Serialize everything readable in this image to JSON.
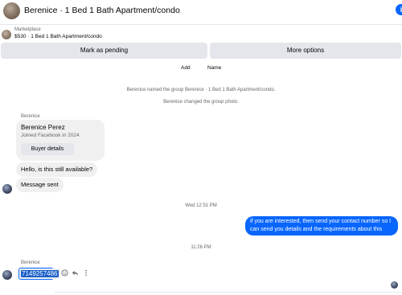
{
  "header": {
    "title": "Berenice · 1 Bed 1 Bath Apartment/condo",
    "info_icon": "info-icon"
  },
  "marketplace": {
    "label": "Marketplace",
    "item": "$530 · 1 Bed 1 Bath Apartment/condo"
  },
  "actions": {
    "pending": "Mark as pending",
    "more": "More options"
  },
  "add_name": {
    "add": "Add",
    "name": "Name"
  },
  "system": {
    "line1": "Berenice named the group Berenice · 1 Bed 1 Bath Apartment/condo.",
    "line2": "Berenice changed the group photo."
  },
  "buyer": {
    "sender": "Berenice",
    "name": "Berenice Perez",
    "joined": "Joined Facebook in 2024",
    "details_button": "Buyer details"
  },
  "messages": {
    "hello": "Hello, is this still available?",
    "sent": "Message sent",
    "time1": "Wed 12:51 PM",
    "outgoing": "if you are interested, then send your contact number so I can send you details and the requirements about this",
    "time2": "11:26 PM",
    "sender2": "Berenice",
    "phone": "7149257486"
  },
  "icons": {
    "react": "smiley-icon",
    "reply": "reply-icon",
    "more": "more-vertical-icon"
  },
  "colors": {
    "accent": "#0866ff",
    "incoming_bubble": "#f0f0f0",
    "selection": "#1a5ec8"
  }
}
